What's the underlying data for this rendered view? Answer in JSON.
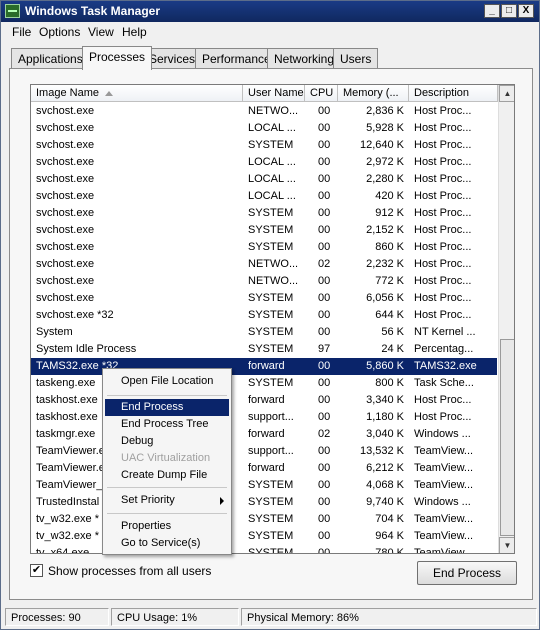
{
  "window": {
    "title": "Windows Task Manager"
  },
  "titlebar_buttons": {
    "minimize": "_",
    "maximize": "□",
    "close": "X"
  },
  "menu": [
    "File",
    "Options",
    "View",
    "Help"
  ],
  "tabs": [
    "Applications",
    "Processes",
    "Services",
    "Performance",
    "Networking",
    "Users"
  ],
  "active_tab": "Processes",
  "columns": [
    "Image Name",
    "User Name",
    "CPU",
    "Memory (...",
    "Description"
  ],
  "rows": [
    [
      "svchost.exe",
      "NETWO...",
      "00",
      "2,836 K",
      "Host Proc..."
    ],
    [
      "svchost.exe",
      "LOCAL ...",
      "00",
      "5,928 K",
      "Host Proc..."
    ],
    [
      "svchost.exe",
      "SYSTEM",
      "00",
      "12,640 K",
      "Host Proc..."
    ],
    [
      "svchost.exe",
      "LOCAL ...",
      "00",
      "2,972 K",
      "Host Proc..."
    ],
    [
      "svchost.exe",
      "LOCAL ...",
      "00",
      "2,280 K",
      "Host Proc..."
    ],
    [
      "svchost.exe",
      "LOCAL ...",
      "00",
      "420 K",
      "Host Proc..."
    ],
    [
      "svchost.exe",
      "SYSTEM",
      "00",
      "912 K",
      "Host Proc..."
    ],
    [
      "svchost.exe",
      "SYSTEM",
      "00",
      "2,152 K",
      "Host Proc..."
    ],
    [
      "svchost.exe",
      "SYSTEM",
      "00",
      "860 K",
      "Host Proc..."
    ],
    [
      "svchost.exe",
      "NETWO...",
      "02",
      "2,232 K",
      "Host Proc..."
    ],
    [
      "svchost.exe",
      "NETWO...",
      "00",
      "772 K",
      "Host Proc..."
    ],
    [
      "svchost.exe",
      "SYSTEM",
      "00",
      "6,056 K",
      "Host Proc..."
    ],
    [
      "svchost.exe *32",
      "SYSTEM",
      "00",
      "644 K",
      "Host Proc..."
    ],
    [
      "System",
      "SYSTEM",
      "00",
      "56 K",
      "NT Kernel ..."
    ],
    [
      "System Idle Process",
      "SYSTEM",
      "97",
      "24 K",
      "Percentag..."
    ],
    [
      "TAMS32.exe *32",
      "forward",
      "00",
      "5,860 K",
      "TAMS32.exe"
    ],
    [
      "taskeng.exe",
      "SYSTEM",
      "00",
      "800 K",
      "Task Sche..."
    ],
    [
      "taskhost.exe",
      "forward",
      "00",
      "3,340 K",
      "Host Proc..."
    ],
    [
      "taskhost.exe",
      "support...",
      "00",
      "1,180 K",
      "Host Proc..."
    ],
    [
      "taskmgr.exe",
      "forward",
      "02",
      "3,040 K",
      "Windows ..."
    ],
    [
      "TeamViewer.e",
      "support...",
      "00",
      "13,532 K",
      "TeamView..."
    ],
    [
      "TeamViewer.e",
      "forward",
      "00",
      "6,212 K",
      "TeamView..."
    ],
    [
      "TeamViewer_",
      "SYSTEM",
      "00",
      "4,068 K",
      "TeamView..."
    ],
    [
      "TrustedInstal",
      "SYSTEM",
      "00",
      "9,740 K",
      "Windows ..."
    ],
    [
      "tv_w32.exe *",
      "SYSTEM",
      "00",
      "704 K",
      "TeamView..."
    ],
    [
      "tv_w32.exe *",
      "SYSTEM",
      "00",
      "964 K",
      "TeamView..."
    ],
    [
      "tv_x64.exe",
      "SYSTEM",
      "00",
      "780 K",
      "TeamView..."
    ]
  ],
  "selected_row": 15,
  "context_menu": {
    "items": [
      {
        "label": "Open File Location",
        "state": "normal"
      },
      {
        "label": "End Process",
        "state": "highlighted"
      },
      {
        "label": "End Process Tree",
        "state": "normal"
      },
      {
        "label": "Debug",
        "state": "normal"
      },
      {
        "label": "UAC Virtualization",
        "state": "disabled"
      },
      {
        "label": "Create Dump File",
        "state": "normal"
      },
      {
        "label": "Set Priority",
        "state": "submenu"
      },
      {
        "label": "Properties",
        "state": "normal"
      },
      {
        "label": "Go to Service(s)",
        "state": "normal"
      }
    ]
  },
  "show_all_users": {
    "label": "Show processes from all users",
    "checked": true
  },
  "end_process_button": "End Process",
  "status": {
    "processes": "Processes: 90",
    "cpu": "CPU Usage: 1%",
    "memory": "Physical Memory: 86%"
  },
  "colors": {
    "titlebar": "#10285f",
    "selection": "#0a246a"
  },
  "icons": [
    "task-manager-icon",
    "sort-ascending-icon",
    "scroll-up-icon",
    "scroll-down-icon",
    "submenu-arrow-icon",
    "checkmark-icon"
  ]
}
